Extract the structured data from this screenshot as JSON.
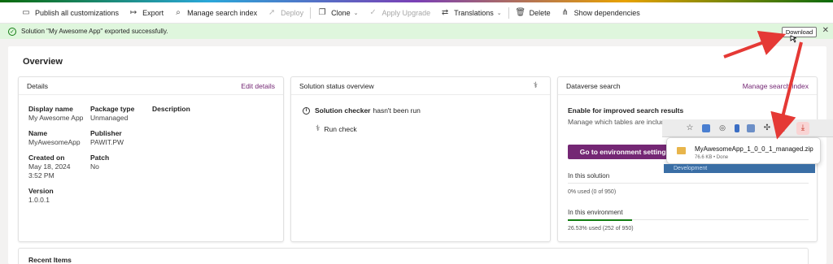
{
  "commandbar": {
    "items": [
      {
        "label": "Publish all customizations",
        "icon": "document-icon",
        "disabled": false,
        "dropdown": false
      },
      {
        "label": "Export",
        "icon": "export-arrow-icon",
        "disabled": false,
        "dropdown": false
      },
      {
        "label": "Manage search index",
        "icon": "search-index-icon",
        "disabled": false,
        "dropdown": false
      },
      {
        "label": "Deploy",
        "icon": "rocket-icon",
        "disabled": true,
        "dropdown": false
      },
      {
        "label": "Clone",
        "icon": "clone-icon",
        "disabled": false,
        "dropdown": true
      },
      {
        "label": "Apply Upgrade",
        "icon": "checkmark-icon",
        "disabled": true,
        "dropdown": false
      },
      {
        "label": "Translations",
        "icon": "translate-icon",
        "disabled": false,
        "dropdown": true
      },
      {
        "label": "Delete",
        "icon": "trash-icon",
        "disabled": false,
        "dropdown": false
      },
      {
        "label": "Show dependencies",
        "icon": "dependencies-icon",
        "disabled": false,
        "dropdown": false
      }
    ]
  },
  "notification": {
    "message": "Solution \"My Awesome App\" exported successfully.",
    "close": "✕",
    "success_color": "#107c10"
  },
  "download_button": "Download",
  "page": {
    "title": "Overview"
  },
  "details": {
    "title": "Details",
    "edit_link": "Edit details",
    "display_name_label": "Display name",
    "display_name_value": "My Awesome App",
    "name_label": "Name",
    "name_value": "MyAwesomeApp",
    "created_on_label": "Created on",
    "created_on_value": "May 18, 2024 3:52 PM",
    "version_label": "Version",
    "version_value": "1.0.0.1",
    "package_type_label": "Package type",
    "package_type_value": "Unmanaged",
    "publisher_label": "Publisher",
    "publisher_value": "PAWIT.PW",
    "patch_label": "Patch",
    "patch_value": "No",
    "description_label": "Description"
  },
  "status": {
    "title": "Solution status overview",
    "checker_bold": "Solution checker",
    "checker_rest": "hasn't been run",
    "run_check": "Run check"
  },
  "dataverse": {
    "title": "Dataverse search",
    "manage_link": "Manage search index",
    "subtitle": "Enable for improved search results",
    "description": "Manage which tables are included ... settings to see the results.",
    "button": "Go to environment settings",
    "in_solution_label": "In this solution",
    "in_solution_value": "0% used (0 of 950)",
    "in_environment_label": "In this environment",
    "in_environment_value": "26.53% used (252 of 950)",
    "in_environment_fraction": 0.2653,
    "accent_color": "#742774"
  },
  "recent": {
    "title": "Recent Items"
  },
  "browser": {
    "download_file": "MyAwesomeApp_1_0_0_1_managed.zip",
    "download_meta": "76.6 KB • Done",
    "badge_count": "1",
    "background_strip": "Development",
    "arrow_color": "#e53935"
  }
}
